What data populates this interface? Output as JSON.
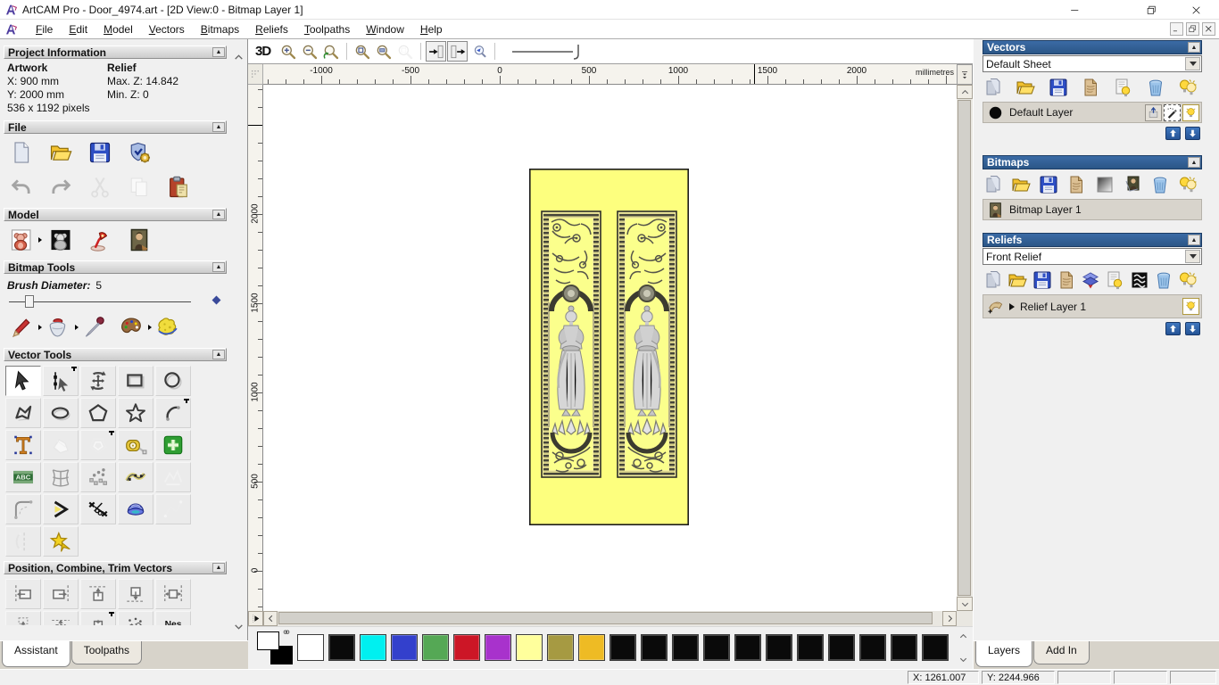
{
  "window": {
    "title": "ArtCAM Pro - Door_4974.art - [2D View:0 - Bitmap Layer 1]"
  },
  "menubar": {
    "menus": [
      {
        "label": "File",
        "accel": "F"
      },
      {
        "label": "Edit",
        "accel": "E"
      },
      {
        "label": "Model",
        "accel": "M"
      },
      {
        "label": "Vectors",
        "accel": "V"
      },
      {
        "label": "Bitmaps",
        "accel": "B"
      },
      {
        "label": "Reliefs",
        "accel": "R"
      },
      {
        "label": "Toolpaths",
        "accel": "T"
      },
      {
        "label": "Window",
        "accel": "W"
      },
      {
        "label": "Help",
        "accel": "H"
      }
    ]
  },
  "toolbar2d": {
    "mode_button": "3D",
    "tools": [
      {
        "icon": "zoom-in"
      },
      {
        "icon": "zoom-out"
      },
      {
        "icon": "zoom-previous"
      },
      "sep",
      {
        "icon": "zoom-page"
      },
      {
        "icon": "zoom-objects"
      },
      {
        "icon": "zoom-selected",
        "state": "disabled"
      },
      "sep",
      {
        "icon": "snap-view-a",
        "bordered": true
      },
      {
        "icon": "snap-view-b",
        "bordered": true
      },
      {
        "icon": "pan-lens"
      },
      "sep"
    ]
  },
  "rulers": {
    "units": "millimetres",
    "h_labels": [
      "-1000",
      "-500",
      "0",
      "500",
      "1000",
      "1500",
      "2000"
    ],
    "v_labels": [
      "2000",
      "1500",
      "1000",
      "500",
      "0"
    ]
  },
  "assistant": {
    "tabs": [
      {
        "label": "Assistant",
        "active": true
      },
      {
        "label": "Toolpaths",
        "active": false
      }
    ],
    "project": {
      "title": "Project Information",
      "artwork_heading": "Artwork",
      "relief_heading": "Relief",
      "x": "X: 900 mm",
      "y": "Y: 2000 mm",
      "pixels": "536 x 1192 pixels",
      "max_z": "Max. Z: 14.842",
      "min_z": "Min. Z: 0"
    },
    "file": {
      "title": "File",
      "row1": [
        {
          "icon": "new-file"
        },
        {
          "icon": "open-folder"
        },
        {
          "icon": "save"
        },
        {
          "icon": "options-shield"
        }
      ],
      "row2": [
        {
          "icon": "undo"
        },
        {
          "icon": "redo"
        },
        {
          "icon": "cut",
          "state": "disabled"
        },
        {
          "icon": "copy",
          "state": "disabled"
        },
        {
          "icon": "paste"
        }
      ]
    },
    "model": {
      "title": "Model",
      "row": [
        {
          "icon": "teddy-red",
          "flyout": true
        },
        {
          "icon": "teddy-black"
        },
        {
          "icon": "lamp"
        },
        {
          "icon": "mona-lisa"
        }
      ]
    },
    "bitmap_tools": {
      "title": "Bitmap Tools",
      "brush_label": "Brush Diameter:",
      "brush_value": "5",
      "row": [
        {
          "icon": "paint-pencil",
          "flyout": true
        },
        {
          "icon": "paint-bucket",
          "flyout": true
        },
        {
          "icon": "colour-picker"
        },
        {
          "icon": "palette",
          "flyout": true
        },
        {
          "icon": "texture-sponge"
        }
      ]
    },
    "vector_tools": {
      "title": "Vector Tools",
      "rows": [
        [
          {
            "icon": "select-arrow",
            "state": "active"
          },
          {
            "icon": "node-select",
            "pin": true
          },
          {
            "icon": "transform-vectors"
          },
          {
            "icon": "rect-tool"
          },
          {
            "icon": "circle-tool"
          }
        ],
        [
          {
            "icon": "polyline-tool"
          },
          {
            "icon": "ellipse-tool"
          },
          {
            "icon": "polygon-tool"
          },
          {
            "icon": "star-tool"
          },
          {
            "icon": "arc-tool",
            "pin": true
          }
        ],
        [
          {
            "icon": "text-tool"
          },
          {
            "icon": "weld-vectors",
            "state": "disabled"
          },
          {
            "icon": "offset-vectors",
            "state": "disabled",
            "pin": true
          },
          {
            "icon": "measure-tool"
          },
          {
            "icon": "paste-plus"
          }
        ],
        [
          {
            "icon": "text-banner"
          },
          {
            "icon": "distort-mesh"
          },
          {
            "icon": "block-paste"
          },
          {
            "icon": "paste-curve"
          },
          {
            "icon": "vector-texture",
            "state": "disabled"
          }
        ],
        [
          {
            "icon": "fillet-tool"
          },
          {
            "icon": "join-vectors"
          },
          {
            "icon": "trim-vectors"
          },
          {
            "icon": "sculpt-dome"
          },
          {
            "icon": "fit-spline",
            "state": "disabled"
          }
        ],
        [
          {
            "icon": "mirror-vectors",
            "state": "disabled"
          },
          {
            "icon": "wizard-star"
          }
        ]
      ]
    },
    "position_tools": {
      "title": "Position, Combine, Trim Vectors",
      "row1": [
        {
          "icon": "align-left"
        },
        {
          "icon": "align-right"
        },
        {
          "icon": "align-top"
        },
        {
          "icon": "align-bottom"
        },
        {
          "icon": "center-horizontal"
        }
      ],
      "row2": [
        {
          "icon": "align-top-b"
        },
        {
          "icon": "align-top-c"
        },
        {
          "icon": "center-vertical",
          "pin": true
        },
        {
          "icon": "nest-scatter"
        },
        {
          "icon": "nesting"
        }
      ]
    }
  },
  "layers_panel": {
    "vectors": {
      "title": "Vectors",
      "sheet_value": "Default Sheet",
      "tools": [
        {
          "icon": "new-file-gray"
        },
        {
          "icon": "open-folder"
        },
        {
          "icon": "save"
        },
        {
          "icon": "merge-page"
        },
        {
          "icon": "bulb-page"
        },
        {
          "icon": "trash"
        },
        {
          "icon": "bulbs"
        }
      ],
      "layer_name": "Default Layer"
    },
    "bitmaps": {
      "title": "Bitmaps",
      "tools": [
        {
          "icon": "new-file-gray"
        },
        {
          "icon": "open-folder"
        },
        {
          "icon": "save"
        },
        {
          "icon": "merge-page"
        },
        {
          "icon": "gradient-square"
        },
        {
          "icon": "mona-copy"
        },
        {
          "icon": "trash"
        },
        {
          "icon": "bulbs"
        }
      ],
      "layer_name": "Bitmap Layer 1"
    },
    "reliefs": {
      "title": "Reliefs",
      "relief_value": "Front Relief",
      "tools": [
        {
          "icon": "new-file-gray"
        },
        {
          "icon": "open-folder"
        },
        {
          "icon": "save"
        },
        {
          "icon": "merge-page"
        },
        {
          "icon": "stack-transfer"
        },
        {
          "icon": "bulb-page"
        },
        {
          "icon": "zebra-preview"
        },
        {
          "icon": "trash"
        },
        {
          "icon": "bulbs"
        }
      ],
      "layer_name": "Relief Layer 1"
    },
    "tabs": [
      {
        "label": "Layers",
        "active": true
      },
      {
        "label": "Add In",
        "active": false
      }
    ]
  },
  "palette": {
    "front_color": "#ffffff",
    "back_color": "#000000",
    "swatches": [
      "#ffffff",
      "#0a0a0a",
      "#00f0f0",
      "#3340cc",
      "#55a855",
      "#cc1626",
      "#a832cc",
      "#ffff9c",
      "#a69a42",
      "#eebb24",
      "#0a0a0a",
      "#0a0a0a",
      "#0a0a0a",
      "#0a0a0a",
      "#0a0a0a",
      "#0a0a0a",
      "#0a0a0a",
      "#0a0a0a",
      "#0a0a0a",
      "#0a0a0a",
      "#0a0a0a"
    ]
  },
  "statusbar": {
    "x": "X: 1261.007",
    "y": "Y: 2244.966"
  }
}
